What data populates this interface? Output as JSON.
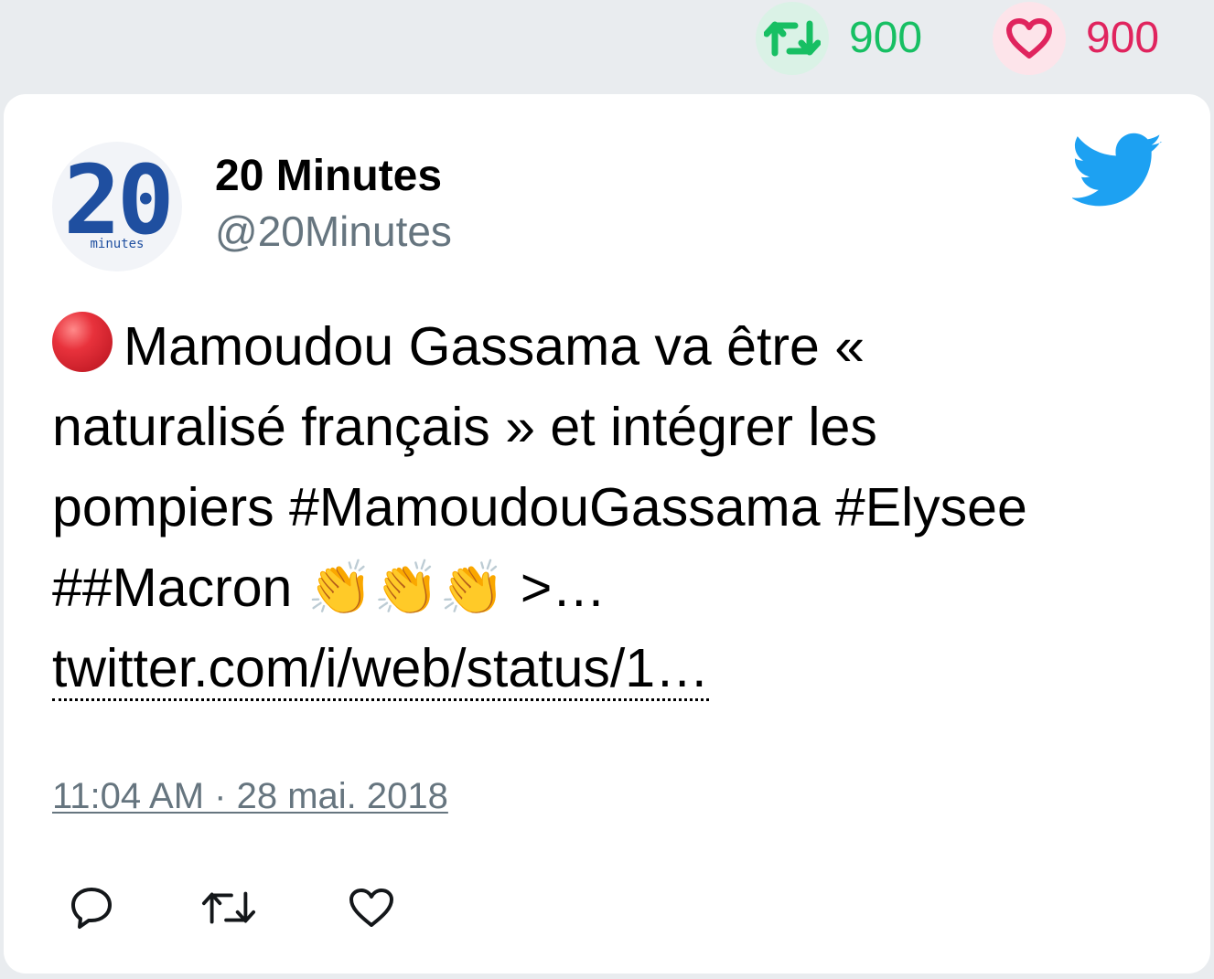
{
  "counters": {
    "retweets": {
      "icon": "retweet-icon",
      "value": "900",
      "color": "#17bf63"
    },
    "likes": {
      "icon": "heart-icon",
      "value": "900",
      "color": "#e0245e"
    }
  },
  "tweet": {
    "author": {
      "name": "20 Minutes",
      "handle": "@20Minutes",
      "avatar_text": "20",
      "avatar_subtext": "minutes"
    },
    "text_lines": [
      "Mamoudou Gassama va être «",
      "naturalisé français » et intégrer les",
      "pompiers #MamoudouGassama #Elysee",
      "##Macron ",
      " >…"
    ],
    "emoji": {
      "clap": "👏👏👏"
    },
    "link": "twitter.com/i/web/status/1…",
    "timestamp": "11:04 AM · 28 mai. 2018",
    "brand_color": "#1da1f2"
  }
}
